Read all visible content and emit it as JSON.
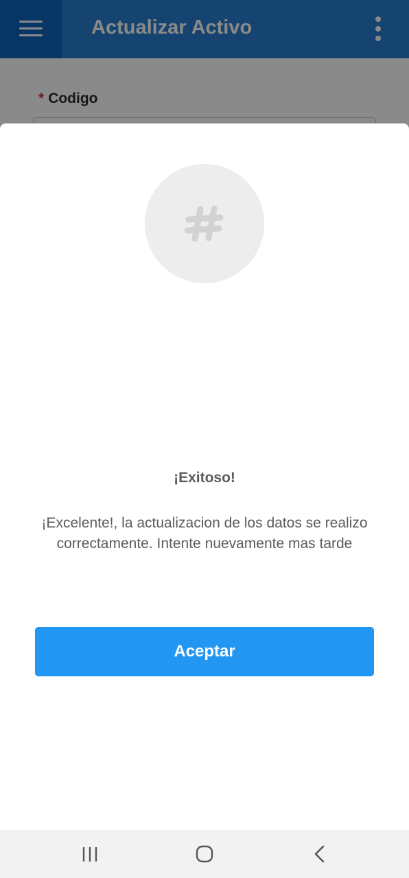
{
  "app_bar": {
    "title": "Actualizar Activo",
    "menu_icon": "hamburger-menu-icon",
    "overflow_icon": "more-vert-icon"
  },
  "form": {
    "code_field": {
      "required_mark": "*",
      "label": "Codigo",
      "value": ""
    }
  },
  "dialog": {
    "icon": "hashtag-icon",
    "title": "¡Exitoso!",
    "message": "¡Excelente!, la actualizacion de los datos se realizo correctamente. Intente nuevamente mas tarde",
    "accept_label": "Aceptar"
  },
  "nav_bar": {
    "recents_icon": "recents-icon",
    "home_icon": "home-icon",
    "back_icon": "back-icon"
  },
  "colors": {
    "primary": "#2196f3",
    "app_bar": "#1976d2",
    "required": "#d32f2f",
    "text_muted": "#5b5b5b"
  }
}
